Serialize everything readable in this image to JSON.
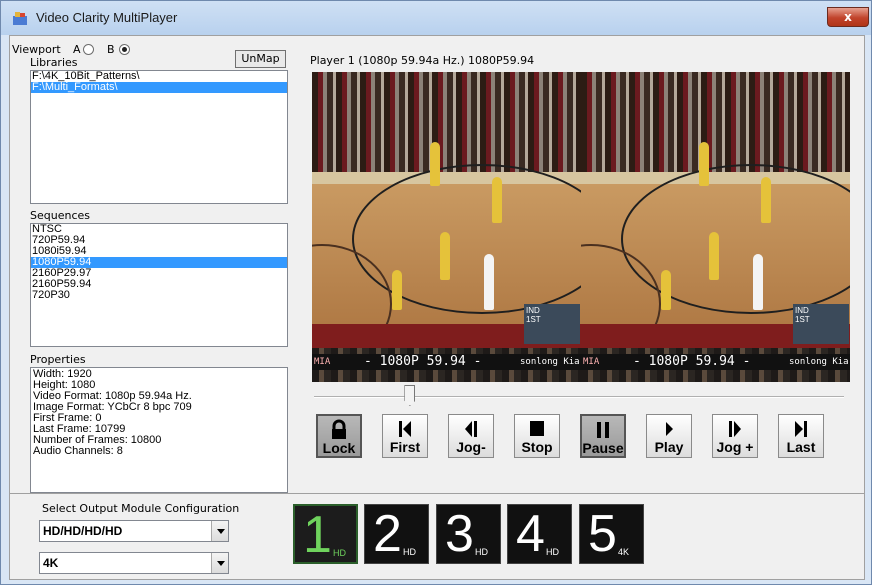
{
  "window": {
    "title": "Video Clarity MultiPlayer",
    "close_label": "x"
  },
  "viewport": {
    "label": "Viewport",
    "option_a": "A",
    "option_b": "B",
    "selected": "B",
    "unmap_label": "UnMap"
  },
  "libraries": {
    "label": "Libraries",
    "items": [
      "F:\\4K_10Bit_Patterns\\",
      "F:\\Multi_Formats\\"
    ],
    "selected_index": 1
  },
  "sequences": {
    "label": "Sequences",
    "items": [
      "NTSC",
      "720P59.94",
      "1080i59.94",
      "1080P59.94",
      "2160P29.97",
      "2160P59.94",
      "720P30"
    ],
    "selected_index": 3
  },
  "properties": {
    "label": "Properties",
    "lines": [
      "Width: 1920",
      "Height: 1080",
      "Video Format: 1080p 59.94a Hz.",
      "Image Format: YCbCr 8 bpc 709",
      "First Frame: 0",
      "Last Frame: 10799",
      "Number of Frames: 10800",
      "Audio Channels: 8"
    ]
  },
  "player": {
    "label": "Player 1  (1080p 59.94a Hz.)  1080P59.94",
    "overlay_left": "- 1080P 59.94 -",
    "overlay_right": "- 1080P 59.94 -",
    "scorebug_team": "IND",
    "scorebug_period": "1ST",
    "ticker_team": "MIA",
    "ticker_sponsor": "sonlong Kia"
  },
  "transport": {
    "position_fraction": 0.18,
    "buttons": [
      {
        "label": "Lock",
        "icon": "lock-icon",
        "pressed": true
      },
      {
        "label": "First",
        "icon": "skip-first-icon",
        "pressed": false
      },
      {
        "label": "Jog-",
        "icon": "jog-back-icon",
        "pressed": false
      },
      {
        "label": "Stop",
        "icon": "stop-icon",
        "pressed": false
      },
      {
        "label": "Pause",
        "icon": "pause-icon",
        "pressed": true
      },
      {
        "label": "Play",
        "icon": "play-icon",
        "pressed": false
      },
      {
        "label": "Jog +",
        "icon": "jog-forward-icon",
        "pressed": false
      },
      {
        "label": "Last",
        "icon": "skip-last-icon",
        "pressed": false
      }
    ]
  },
  "output": {
    "label": "Select Output Module Configuration",
    "config_value": "HD/HD/HD/HD",
    "resolution_value": "4K",
    "modules": [
      {
        "number": "1",
        "sub": "HD",
        "active": true
      },
      {
        "number": "2",
        "sub": "HD",
        "active": false
      },
      {
        "number": "3",
        "sub": "HD",
        "active": false
      },
      {
        "number": "4",
        "sub": "HD",
        "active": false
      },
      {
        "number": "5",
        "sub": "4K",
        "active": false
      }
    ]
  },
  "colors": {
    "selection": "#3399ff",
    "active_module": "#6fd35d",
    "close_button": "#c1432b"
  }
}
